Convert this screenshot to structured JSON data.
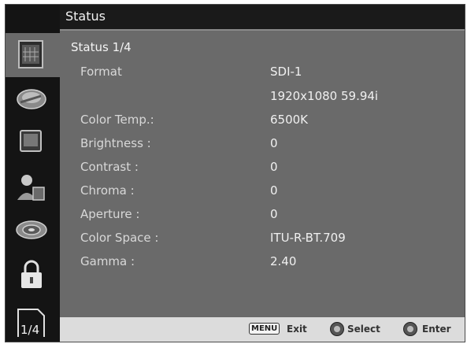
{
  "window": {
    "title": "Status"
  },
  "sidebar": {
    "items": [
      {
        "icon": "status-icon"
      },
      {
        "icon": "picture-icon"
      },
      {
        "icon": "monitor-icon"
      },
      {
        "icon": "user-settings-icon"
      },
      {
        "icon": "disc-icon"
      },
      {
        "icon": "lock-icon"
      },
      {
        "icon": "page-indicator-icon",
        "label": "1/4"
      }
    ]
  },
  "status": {
    "heading": "Status 1/4",
    "rows": [
      {
        "label": "Format",
        "value": "SDI-1"
      },
      {
        "label": "",
        "value": "1920x1080 59.94i"
      },
      {
        "label": "Color Temp.:",
        "value": "6500K"
      },
      {
        "label": "Brightness :",
        "value": "0"
      },
      {
        "label": "Contrast :",
        "value": "0"
      },
      {
        "label": "Chroma :",
        "value": "0"
      },
      {
        "label": "Aperture :",
        "value": "0"
      },
      {
        "label": "Color Space :",
        "value": "ITU-R-BT.709"
      },
      {
        "label": "Gamma :",
        "value": "2.40"
      }
    ]
  },
  "footer": {
    "menu_key": "MENU",
    "exit_label": "Exit",
    "select_label": "Select",
    "enter_label": "Enter"
  }
}
